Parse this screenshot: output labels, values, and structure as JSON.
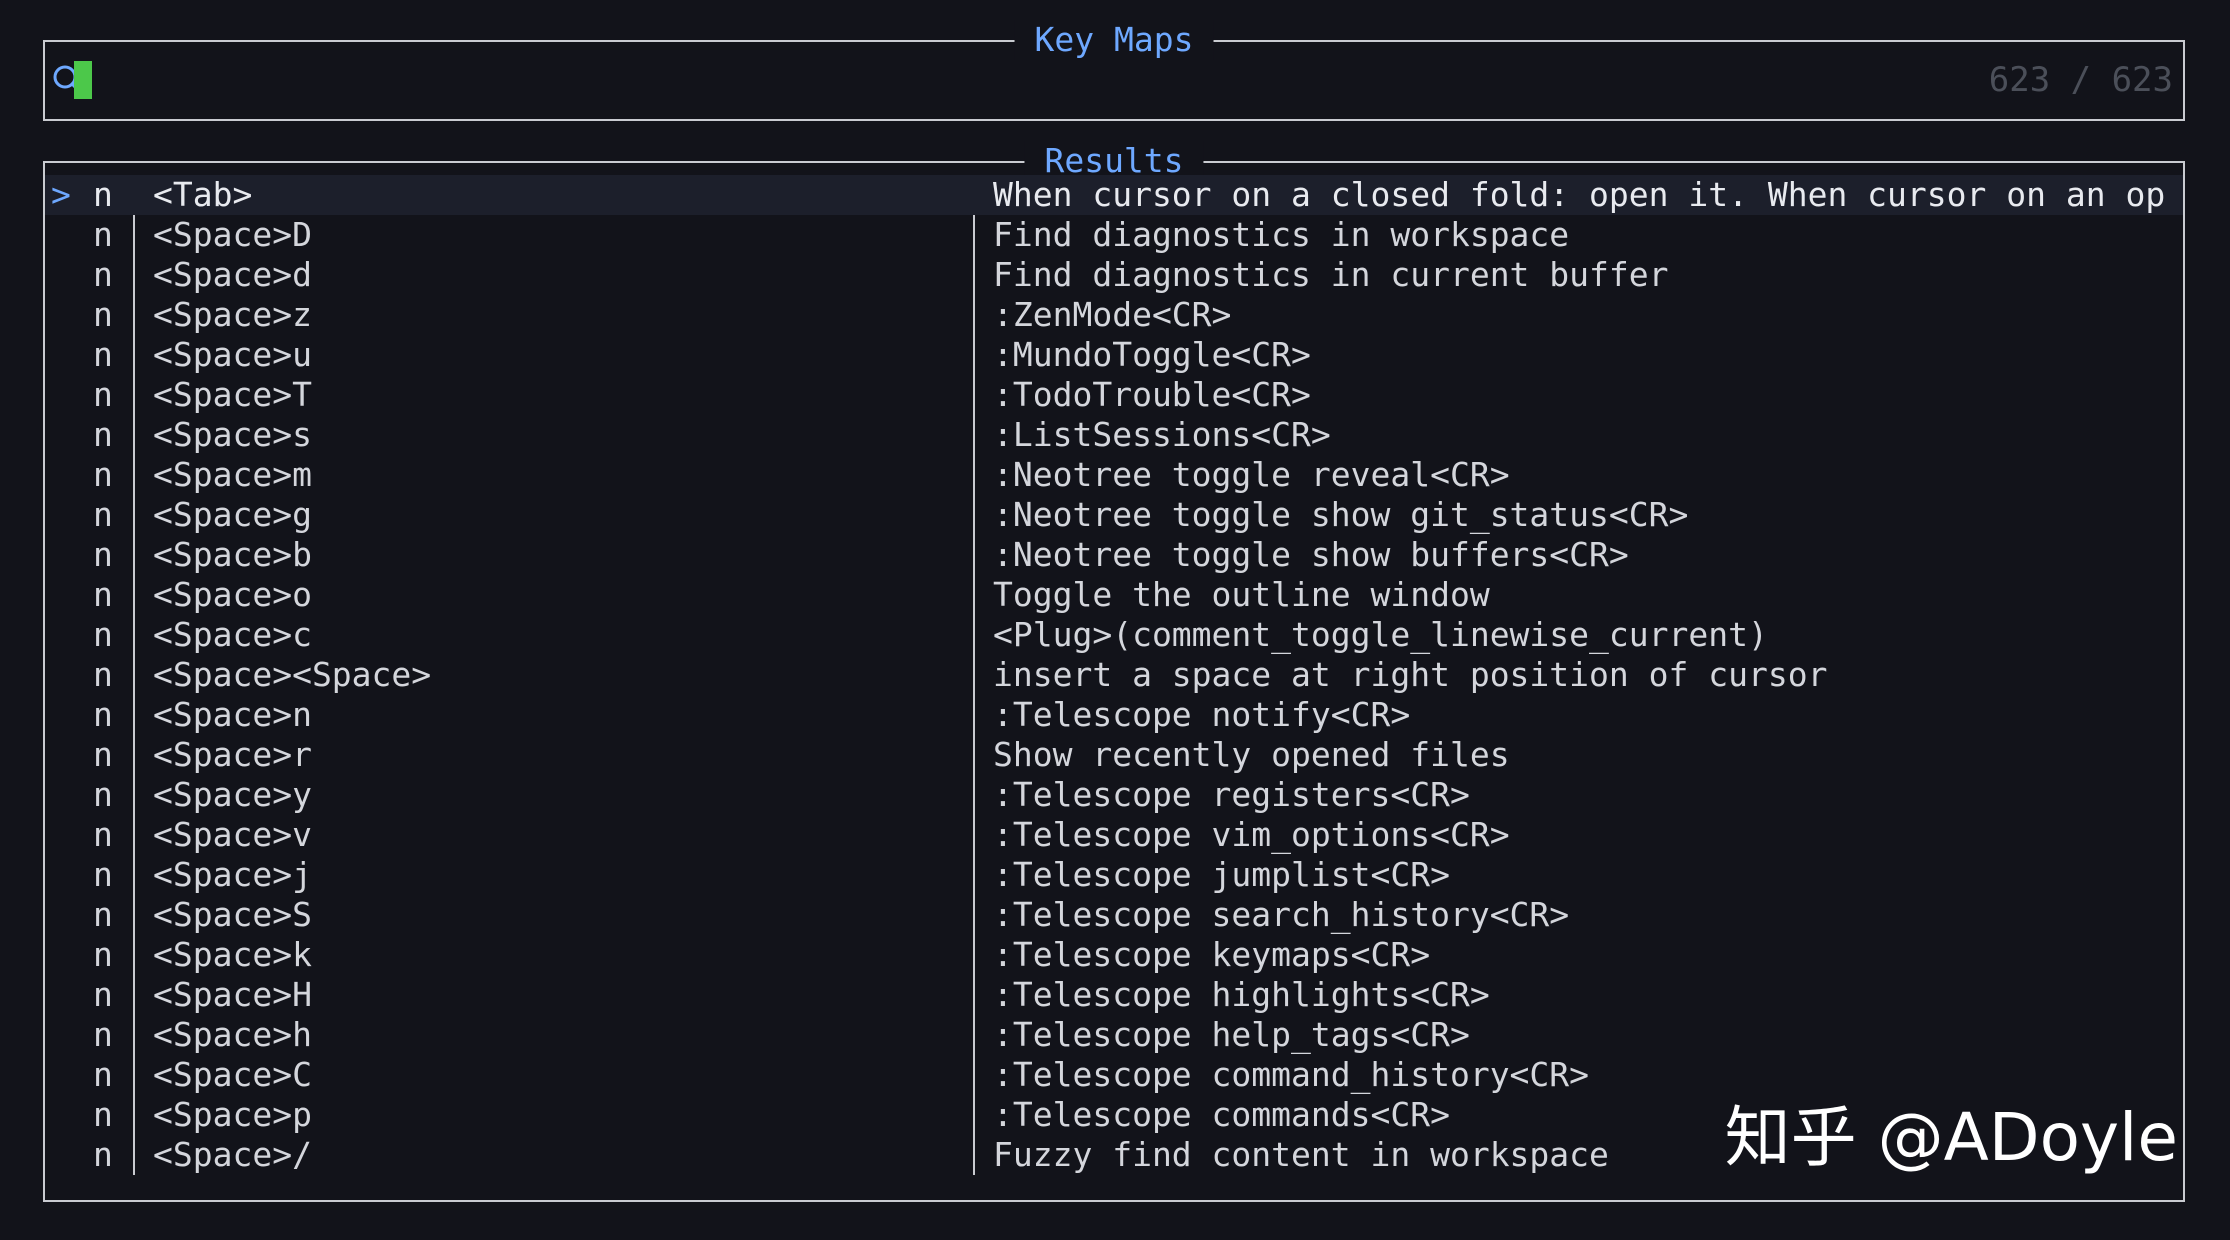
{
  "prompt": {
    "title": "Key Maps",
    "query": "",
    "counter": "623 / 623"
  },
  "results": {
    "title": "Results",
    "caret": ">",
    "rows": [
      {
        "mode": "n",
        "keys": "<Tab>",
        "desc": "When cursor on a closed fold: open it. When cursor on an op",
        "selected": true
      },
      {
        "mode": "n",
        "keys": "<Space>D",
        "desc": "Find diagnostics in workspace"
      },
      {
        "mode": "n",
        "keys": "<Space>d",
        "desc": "Find diagnostics in current buffer"
      },
      {
        "mode": "n",
        "keys": "<Space>z",
        "desc": ":ZenMode<CR>"
      },
      {
        "mode": "n",
        "keys": "<Space>u",
        "desc": ":MundoToggle<CR>"
      },
      {
        "mode": "n",
        "keys": "<Space>T",
        "desc": ":TodoTrouble<CR>"
      },
      {
        "mode": "n",
        "keys": "<Space>s",
        "desc": ":ListSessions<CR>"
      },
      {
        "mode": "n",
        "keys": "<Space>m",
        "desc": ":Neotree toggle reveal<CR>"
      },
      {
        "mode": "n",
        "keys": "<Space>g",
        "desc": ":Neotree toggle show git_status<CR>"
      },
      {
        "mode": "n",
        "keys": "<Space>b",
        "desc": ":Neotree toggle show buffers<CR>"
      },
      {
        "mode": "n",
        "keys": "<Space>o",
        "desc": "Toggle the outline window"
      },
      {
        "mode": "n",
        "keys": "<Space>c",
        "desc": "<Plug>(comment_toggle_linewise_current)"
      },
      {
        "mode": "n",
        "keys": "<Space><Space>",
        "desc": "insert a space at right position of cursor"
      },
      {
        "mode": "n",
        "keys": "<Space>n",
        "desc": ":Telescope notify<CR>"
      },
      {
        "mode": "n",
        "keys": "<Space>r",
        "desc": "Show recently opened files"
      },
      {
        "mode": "n",
        "keys": "<Space>y",
        "desc": ":Telescope registers<CR>"
      },
      {
        "mode": "n",
        "keys": "<Space>v",
        "desc": ":Telescope vim_options<CR>"
      },
      {
        "mode": "n",
        "keys": "<Space>j",
        "desc": ":Telescope jumplist<CR>"
      },
      {
        "mode": "n",
        "keys": "<Space>S",
        "desc": ":Telescope search_history<CR>"
      },
      {
        "mode": "n",
        "keys": "<Space>k",
        "desc": ":Telescope keymaps<CR>"
      },
      {
        "mode": "n",
        "keys": "<Space>H",
        "desc": ":Telescope highlights<CR>"
      },
      {
        "mode": "n",
        "keys": "<Space>h",
        "desc": ":Telescope help_tags<CR>"
      },
      {
        "mode": "n",
        "keys": "<Space>C",
        "desc": ":Telescope command_history<CR>"
      },
      {
        "mode": "n",
        "keys": "<Space>p",
        "desc": ":Telescope commands<CR>"
      },
      {
        "mode": "n",
        "keys": "<Space>/",
        "desc": "Fuzzy find content in workspace"
      }
    ]
  },
  "watermark": "知乎 @ADoyle",
  "colors": {
    "background": "#12131a",
    "border": "#c9cbd1",
    "title": "#6ea8ff",
    "cursor": "#4cc84a",
    "selection": "#1c1f2b",
    "counter": "#4b4f59"
  },
  "icons": {
    "prompt": "search-icon"
  }
}
